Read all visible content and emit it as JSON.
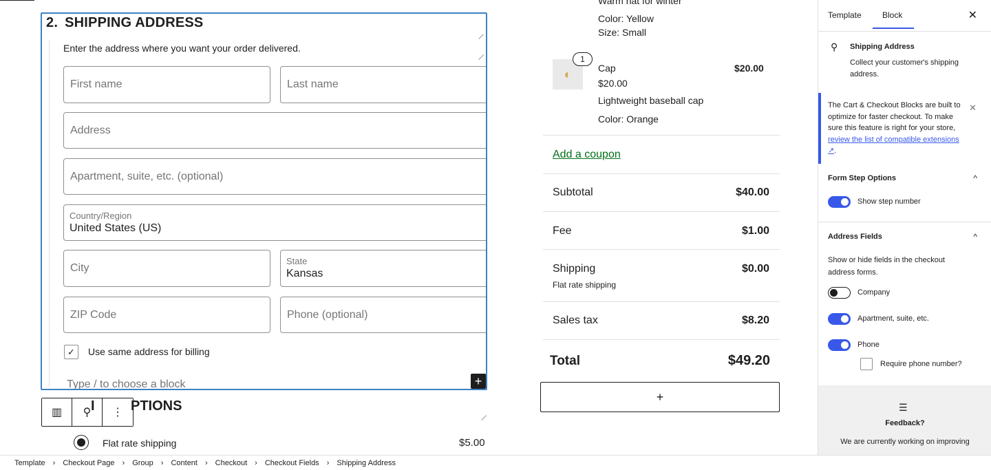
{
  "shipping": {
    "step_number": "2.",
    "heading": "SHIPPING ADDRESS",
    "description": "Enter the address where you want your order delivered.",
    "fields": {
      "first_name": "First name",
      "last_name": "Last name",
      "address": "Address",
      "apartment": "Apartment, suite, etc. (optional)",
      "country_label": "Country/Region",
      "country_value": "United States (US)",
      "city": "City",
      "state_label": "State",
      "state_value": "Kansas",
      "zip": "ZIP Code",
      "phone": "Phone (optional)"
    },
    "same_billing_label": "Use same address for billing",
    "type_hint": "Type / to choose a block",
    "add_icon": "+"
  },
  "toolbar": {
    "block_type_icon": "▥",
    "location_icon": "⚲",
    "more_icon": "⋮"
  },
  "shipping_options": {
    "heading_visible": "PTIONS",
    "heading_prefix": "I",
    "rate_label": "Flat rate shipping",
    "rate_price": "$5.00"
  },
  "order_summary": {
    "item1": {
      "partial_name": "Warm hat for winter",
      "color": "Color: Yellow",
      "size": "Size: Small"
    },
    "item2": {
      "quantity": "1",
      "name": "Cap",
      "price": "$20.00",
      "unit_price": "$20.00",
      "description": "Lightweight baseball cap",
      "color": "Color: Orange"
    },
    "coupon_link": "Add a coupon",
    "subtotal_label": "Subtotal",
    "subtotal_value": "$40.00",
    "fee_label": "Fee",
    "fee_value": "$1.00",
    "shipping_label": "Shipping",
    "shipping_value": "$0.00",
    "shipping_method": "Flat rate shipping",
    "tax_label": "Sales tax",
    "tax_value": "$8.20",
    "total_label": "Total",
    "total_value": "$49.20",
    "add_block_icon": "+"
  },
  "sidebar": {
    "tabs": [
      "Template",
      "Block"
    ],
    "active_tab": "Block",
    "close_icon": "✕",
    "block_title": "Shipping Address",
    "block_desc_line1": "Collect your customer's shipping",
    "block_desc_line2": "address.",
    "notice_text": "The Cart & Checkout Blocks are built to optimize for faster checkout. To make sure this feature is right for your store,",
    "notice_link": "review the list of compatible extensions",
    "notice_link_icon": "↗",
    "notice_end": ".",
    "form_step_heading": "Form Step Options",
    "show_step_number": "Show step number",
    "address_fields_heading": "Address Fields",
    "address_fields_desc_line1": "Show or hide fields in the checkout",
    "address_fields_desc_line2": "address forms.",
    "company": "Company",
    "apartment": "Apartment, suite, etc.",
    "phone": "Phone",
    "require_phone": "Require phone number?",
    "feedback_icon": "☰",
    "feedback_title": "Feedback?",
    "feedback_text": "We are currently working on improving",
    "chevron_icon": "^"
  },
  "breadcrumb": [
    "Template",
    "Checkout Page",
    "Group",
    "Content",
    "Checkout",
    "Checkout Fields",
    "Shipping Address"
  ],
  "colors": {
    "accent": "#3858e9",
    "selection": "#3b82c4",
    "coupon": "#007017"
  }
}
